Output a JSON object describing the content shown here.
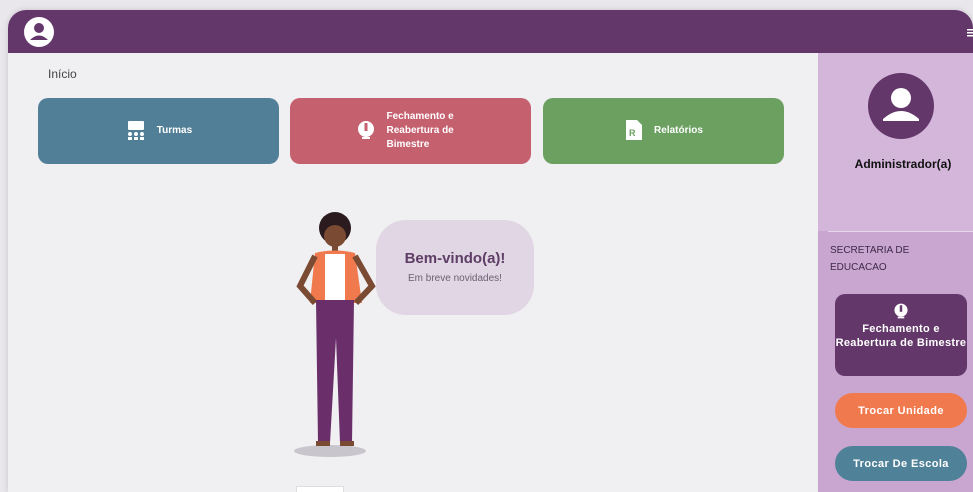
{
  "header": {
    "user_icon": "user-circle-icon",
    "menu_icon": "hamburger-icon"
  },
  "breadcrumb": "Início",
  "tiles": [
    {
      "label": "Turmas",
      "icon": "classroom-icon",
      "color": "#527f98"
    },
    {
      "label": "Fechamento e Reabertura de Bimestre",
      "icon": "monitor-icon",
      "color": "#c5606f"
    },
    {
      "label": "Relatórios",
      "icon": "report-icon",
      "color": "#6ba060"
    }
  ],
  "welcome": {
    "title": "Bem-vindo(a)!",
    "subtitle": "Em breve novidades!"
  },
  "sidebar": {
    "role": "Administrador(a)",
    "school": "SECRETARIA DE EDUCACAO",
    "fechamento": "Fechamento e Reabertura de Bimestre",
    "trocar_unidade": "Trocar Unidade",
    "trocar_escola": "Trocar De Escola"
  },
  "colors": {
    "primary": "#63376a",
    "sidebar": "#c8a6d0",
    "orange": "#f07a4e",
    "teal": "#4f8198"
  }
}
